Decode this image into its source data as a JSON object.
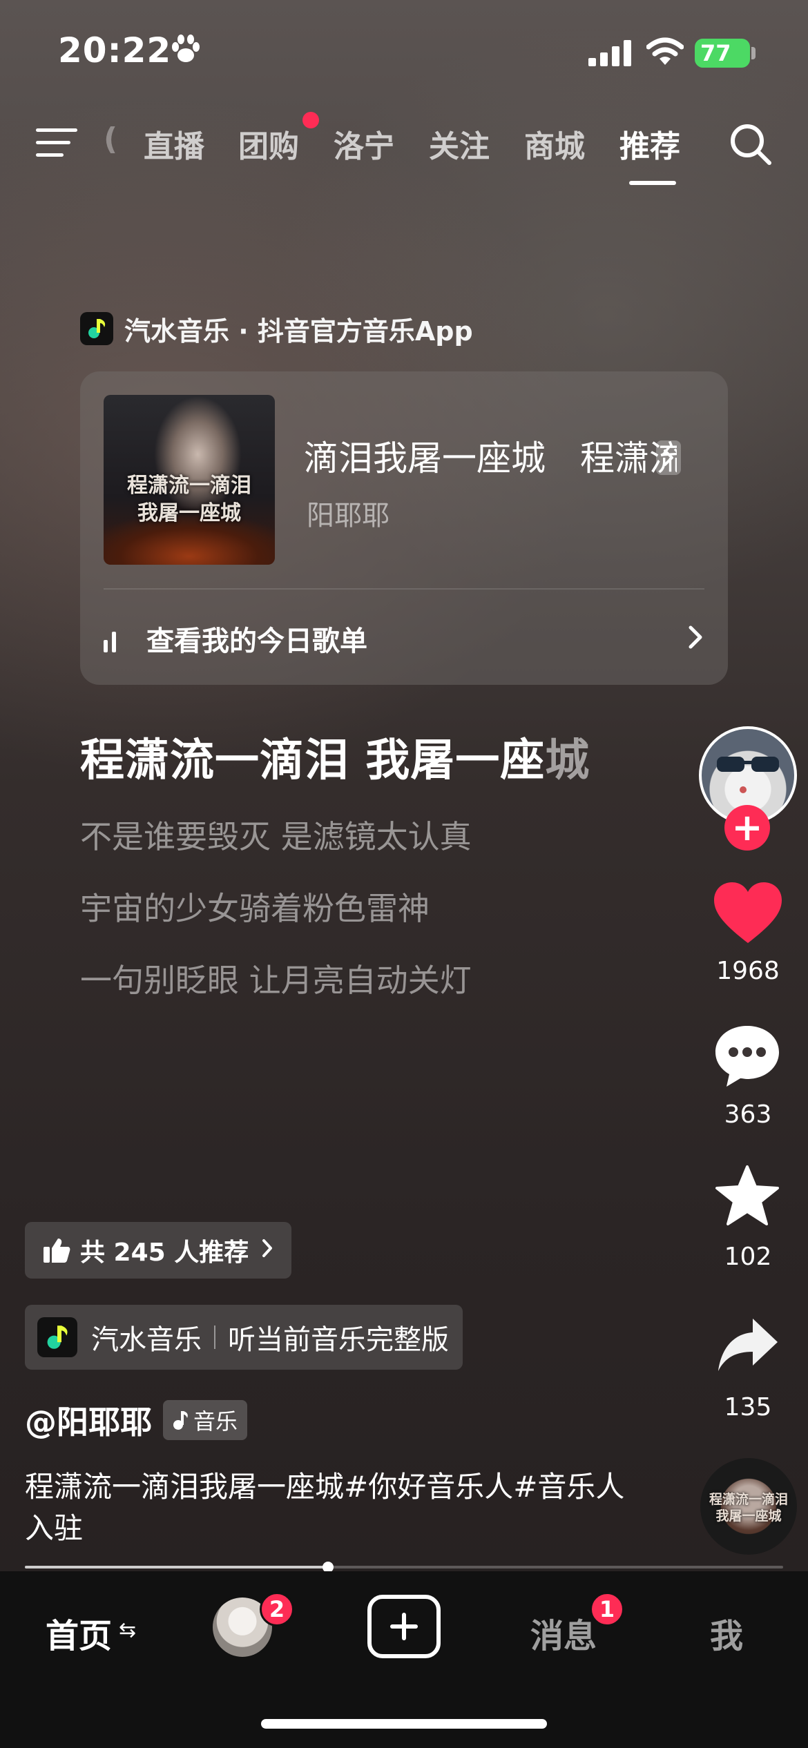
{
  "status_bar": {
    "time": "20:22",
    "battery": "77",
    "icons": [
      "paw-icon",
      "signal-icon",
      "wifi-icon",
      "battery-icon"
    ]
  },
  "top_tabs": {
    "partial_tab": "(",
    "tabs": [
      "直播",
      "团购",
      "洛宁",
      "关注",
      "商城",
      "推荐"
    ],
    "active": "推荐",
    "dot_on": "团购",
    "accent": "#fe2c55"
  },
  "music_card": {
    "source": "汽水音乐 · 抖音官方音乐App",
    "album_art_text": [
      "程潇流一滴泪",
      "我屠一座城"
    ],
    "song_title": "滴泪我屠一座城　程潇流一滴泪我屠一座城",
    "artist": "阳耶耶",
    "playlist_label": "查看我的今日歌单"
  },
  "lyrics": {
    "current_bright": "程潇流一滴泪 我屠一座",
    "current_dim": "城",
    "lines": [
      "不是谁要毁灭 是滤镜太认真",
      "宇宙的少女骑着粉色雷神",
      "一句别眨眼 让月亮自动关灯"
    ]
  },
  "side_actions": {
    "follow": "+",
    "likes": "1968",
    "comments": "363",
    "favorites": "102",
    "shares": "135"
  },
  "info": {
    "recommend": "共 245 人推荐",
    "qishui_name": "汽水音乐",
    "qishui_action": "听当前音乐完整版",
    "author": "@阳耶耶",
    "music_tag": "音乐",
    "description": "程潇流一滴泪我屠一座城#你好音乐人#音乐人入驻"
  },
  "disc_text": [
    "程潇流一滴泪",
    "我屠一座城"
  ],
  "progress": 0.4,
  "bottom_nav": {
    "home": "首页",
    "home_swap": "⇆",
    "friends_badge": "2",
    "messages": "消息",
    "messages_badge": "1",
    "me": "我"
  }
}
